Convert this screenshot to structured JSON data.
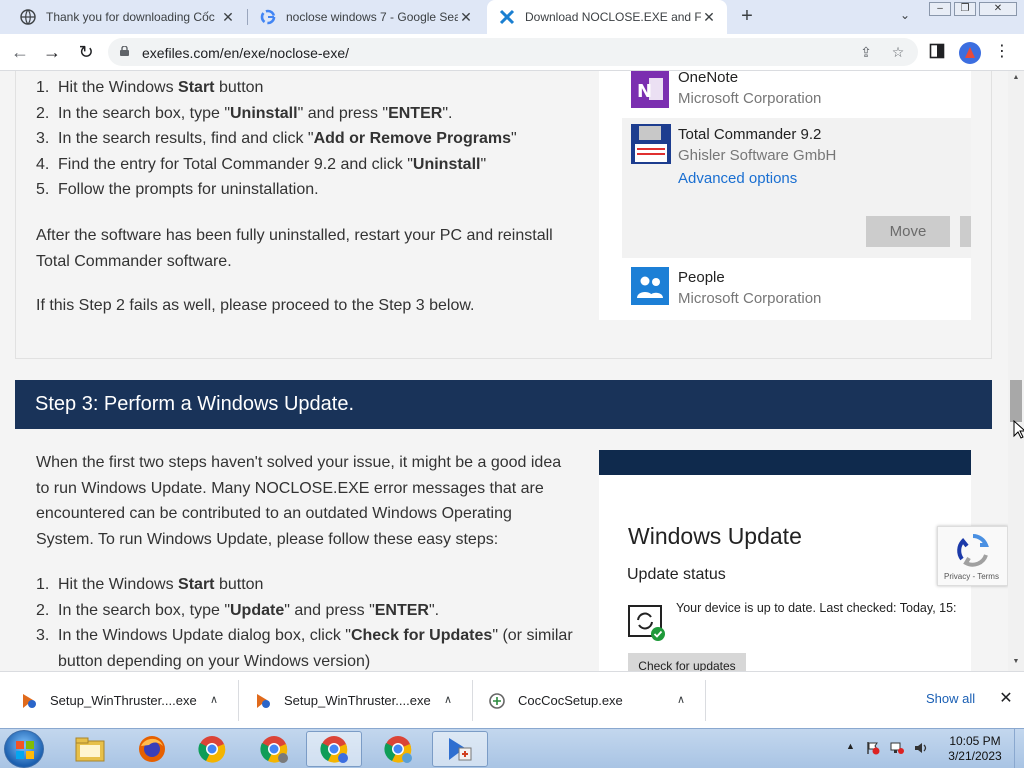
{
  "browser": {
    "tabs": [
      {
        "title": "Thank you for downloading Cốc"
      },
      {
        "title": "noclose windows 7 - Google Sea"
      },
      {
        "title": "Download NOCLOSE.EXE and Fix"
      }
    ],
    "url": "exefiles.com/en/exe/noclose-exe/"
  },
  "step2": {
    "steps": [
      {
        "num": "1.",
        "pre": "Hit the Windows ",
        "bold": "Start",
        "post": " button"
      },
      {
        "num": "2.",
        "pre": "In the search box, type \"",
        "bold": "Uninstall",
        "mid": "\" and press \"",
        "bold2": "ENTER",
        "post": "\"."
      },
      {
        "num": "3.",
        "pre": "In the search results, find and click \"",
        "bold": "Add or Remove Programs",
        "post": "\""
      },
      {
        "num": "4.",
        "pre": "Find the entry for Total Commander 9.2 and click \"",
        "bold": "Uninstall",
        "post": "\""
      },
      {
        "num": "5.",
        "pre": "Follow the prompts for uninstallation.",
        "bold": "",
        "post": ""
      }
    ],
    "after_line1": "After the software has been fully uninstalled, restart your PC and reinstall",
    "after_line2": "Total Commander software.",
    "fail_text": "If this Step 2 fails as well, please proceed to the Step 3 below."
  },
  "apps_panel": {
    "apps": [
      {
        "name": "OneNote",
        "publisher": "Microsoft Corporation"
      },
      {
        "name": "Total Commander 9.2",
        "publisher": "Ghisler Software GmbH",
        "advanced": "Advanced options"
      },
      {
        "name": "People",
        "publisher": "Microsoft Corporation"
      }
    ],
    "move_label": "Move"
  },
  "step3": {
    "heading": "Step 3: Perform a Windows Update.",
    "intro_lines": [
      "When the first two steps haven't solved your issue, it might be a good idea",
      "to run Windows Update. Many NOCLOSE.EXE error messages that are",
      "encountered can be contributed to an outdated Windows Operating",
      "System. To run Windows Update, please follow these easy steps:"
    ],
    "steps": [
      {
        "num": "1.",
        "pre": "Hit the Windows ",
        "bold": "Start",
        "post": " button"
      },
      {
        "num": "2.",
        "pre": "In the search box, type \"",
        "bold": "Update",
        "mid": "\" and press \"",
        "bold2": "ENTER",
        "post": "\"."
      },
      {
        "num": "3.",
        "pre": "In the Windows Update dialog box, click \"",
        "bold": "Check for Updates",
        "post": "\" (or similar",
        "line2": "button depending on your Windows version)"
      }
    ]
  },
  "windows_update": {
    "title": "Windows Update",
    "status_heading": "Update status",
    "message": "Your device is up to date. Last checked: Today, 15:",
    "check_button": "Check for updates"
  },
  "recaptcha": {
    "links": "Privacy - Terms"
  },
  "downloads": {
    "items": [
      {
        "name": "Setup_WinThruster....exe"
      },
      {
        "name": "Setup_WinThruster....exe"
      },
      {
        "name": "CocCocSetup.exe"
      }
    ],
    "show_all": "Show all"
  },
  "taskbar": {
    "time": "10:05 PM",
    "date": "3/21/2023"
  },
  "colors": {
    "step_header": "#193359",
    "link": "#1a6fd1",
    "tabstrip": "#dfe7f6"
  }
}
